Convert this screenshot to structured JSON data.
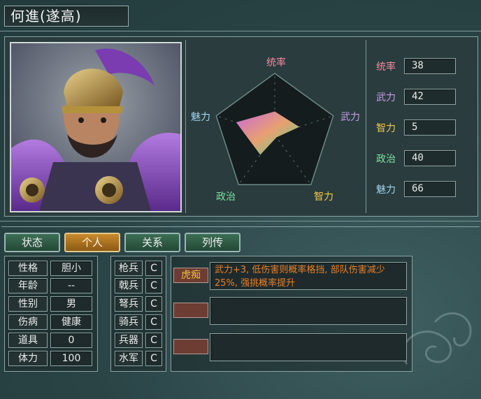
{
  "officer": {
    "name": "何進(遂高)"
  },
  "radar": {
    "labels": {
      "top": "统率",
      "right": "武力",
      "bottom_right": "智力",
      "bottom_left": "政治",
      "left": "魅力"
    },
    "values": {
      "统率": 38,
      "武力": 42,
      "智力": 5,
      "政治": 40,
      "魅力": 66
    },
    "max": 100,
    "colors": {
      "统率": "#f08aa0",
      "武力": "#c69be8",
      "智力": "#f2c84a",
      "政治": "#7fe0a0",
      "魅力": "#9fd4f0"
    }
  },
  "stats": [
    {
      "label": "统率",
      "value": "38",
      "color": "#f08aa0"
    },
    {
      "label": "武力",
      "value": "42",
      "color": "#c69be8"
    },
    {
      "label": "智力",
      "value": "5",
      "color": "#f2c84a"
    },
    {
      "label": "政治",
      "value": "40",
      "color": "#7fe0a0"
    },
    {
      "label": "魅力",
      "value": "66",
      "color": "#9fd4f0"
    }
  ],
  "tabs": [
    "状态",
    "个人",
    "关系",
    "列传"
  ],
  "active_tab": "个人",
  "personal": [
    {
      "label": "性格",
      "value": "胆小"
    },
    {
      "label": "年龄",
      "value": "--"
    },
    {
      "label": "性别",
      "value": "男"
    },
    {
      "label": "伤病",
      "value": "健康"
    },
    {
      "label": "道具",
      "value": "0"
    },
    {
      "label": "体力",
      "value": "100"
    }
  ],
  "aptitude": [
    {
      "label": "枪兵",
      "value": "C"
    },
    {
      "label": "戟兵",
      "value": "C"
    },
    {
      "label": "弩兵",
      "value": "C"
    },
    {
      "label": "骑兵",
      "value": "C"
    },
    {
      "label": "兵器",
      "value": "C"
    },
    {
      "label": "水军",
      "value": "C"
    }
  ],
  "skills": [
    {
      "name": "虎痴",
      "desc": "武力+3, 低伤害则概率格挡, 部队伤害减少25%, 强挑概率提升"
    },
    {
      "name": "",
      "desc": ""
    },
    {
      "name": "",
      "desc": ""
    }
  ]
}
